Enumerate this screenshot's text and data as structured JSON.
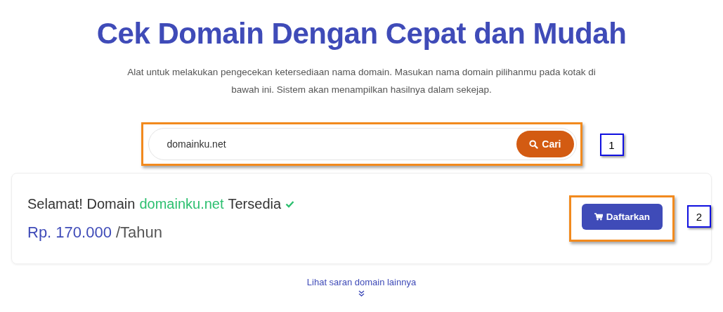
{
  "title": "Cek Domain Dengan Cepat dan Mudah",
  "description": "Alat untuk melakukan pengecekan ketersediaan nama domain. Masukan nama domain pilihanmu pada kotak di bawah ini. Sistem akan menampilkan hasilnya dalam sekejap.",
  "search": {
    "value": "domainku.net",
    "button": "Cari",
    "callout": "1"
  },
  "result": {
    "prefix": "Selamat! Domain",
    "domain": "domainku.net",
    "suffix": "Tersedia",
    "available": true,
    "price": "Rp. 170.000",
    "period": "/Tahun",
    "register_button": "Daftarkan",
    "callout": "2"
  },
  "suggest_link": "Lihat saran domain lainnya"
}
